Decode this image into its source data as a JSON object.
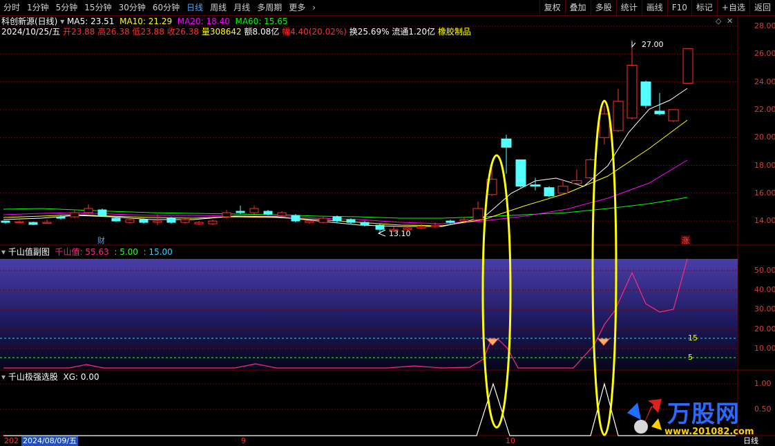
{
  "toolbar": {
    "periods": [
      "分时",
      "1分钟",
      "5分钟",
      "15分钟",
      "30分钟",
      "60分钟",
      "日线",
      "周线",
      "月线",
      "多周期",
      "更多"
    ],
    "active_period": "日线",
    "right_items": [
      "复权",
      "叠加",
      "多股",
      "统计",
      "画线",
      "F10",
      "标记",
      "+自选",
      "返回"
    ]
  },
  "stock": {
    "name": "科创新源(日线)",
    "ma5": "MA5: 23.51",
    "ma10": "MA10: 21.29",
    "ma20": "MA20: 18.40",
    "ma60": "MA60: 15.65",
    "date": "2024/10/25/五",
    "open_label": "开",
    "open": "23.88",
    "high_label": "高",
    "high": "26.38",
    "low_label": "低",
    "low": "23.88",
    "close_label": "收",
    "close": "26.38",
    "vol_label": "量",
    "vol": "308642",
    "amount": "额8.08亿",
    "range_label": "幅",
    "range": "4.40(20.02%)",
    "turnover": "换25.69%",
    "float": "流通1.20亿",
    "sector": "橡胶制品",
    "max_label": "27.00",
    "min_label": "13.10",
    "cai_marker": "财",
    "zhang_marker": "涨"
  },
  "sub1": {
    "title": "千山值副图",
    "value": "千山值: 55.63",
    "line5": ": 5.00",
    "line15": ": 15.00",
    "label15": "15",
    "label5": "5"
  },
  "sub2": {
    "title": "千山极强选股",
    "xg": "XG: 0.00"
  },
  "axis": {
    "main": [
      "28.00",
      "26.00",
      "24.00",
      "22.00",
      "20.00",
      "18.00",
      "16.00",
      "14.00"
    ],
    "sub1": [
      "50.00",
      "40.00",
      "30.00",
      "20.00",
      "10.00"
    ],
    "sub2": [
      "1.00",
      "0.50"
    ]
  },
  "dates": {
    "start": "202",
    "cursor": "2024/08/09/五",
    "m9": "9",
    "m10": "10",
    "period": "日线"
  },
  "logo": {
    "text": "万股网",
    "url": "www.201082.com"
  },
  "colors": {
    "up": "#ff3030",
    "down": "#54ffff",
    "ma5": "#ffffff",
    "ma10": "#ffff00",
    "ma20": "#ff00ff",
    "ma60": "#00ff00",
    "highlight": "#ffff00"
  }
}
